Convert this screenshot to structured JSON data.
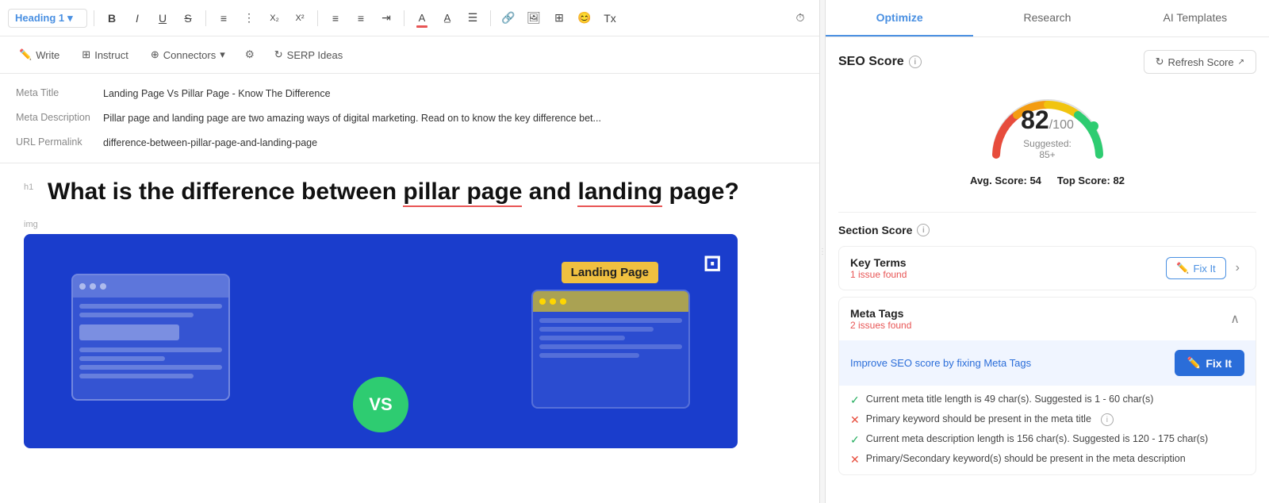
{
  "toolbar": {
    "heading_select": "Heading 1",
    "buttons": [
      "bold",
      "italic",
      "underline",
      "strikethrough",
      "ordered-list",
      "unordered-list",
      "subscript",
      "superscript",
      "align-left",
      "align-right",
      "indent",
      "outdent",
      "text-color",
      "text-bg",
      "align-center",
      "link",
      "image",
      "table",
      "emoji",
      "clear-format"
    ],
    "history_label": "⏱"
  },
  "secondary_toolbar": {
    "write_label": "Write",
    "instruct_label": "Instruct",
    "connectors_label": "Connectors",
    "serp_label": "SERP Ideas"
  },
  "meta": {
    "title_label": "Meta Title",
    "title_value": "Landing Page Vs Pillar Page - Know The Difference",
    "desc_label": "Meta Description",
    "desc_value": "Pillar page and landing page are two amazing ways of digital marketing. Read on to know the key difference bet...",
    "url_label": "URL Permalink",
    "url_value": "difference-between-pillar-page-and-landing-page"
  },
  "content": {
    "heading_tag": "h1",
    "article_title_part1": "What is the difference between ",
    "article_title_highlight1": "pillar page",
    "article_title_part2": " and ",
    "article_title_highlight2": "landing",
    "article_title_part3": " page?",
    "img_label": "img",
    "landing_page_label": "Landing Page",
    "vs_label": "VS"
  },
  "right_panel": {
    "tab_optimize": "Optimize",
    "tab_research": "Research",
    "tab_ai_templates": "AI Templates",
    "seo_score_title": "SEO Score",
    "refresh_btn": "Refresh Score",
    "score_value": "82",
    "score_denom": "/100",
    "score_suggested": "Suggested: 85+",
    "avg_score_label": "Avg. Score:",
    "avg_score_value": "54",
    "top_score_label": "Top Score:",
    "top_score_value": "82",
    "section_score_title": "Section Score",
    "key_terms_title": "Key Terms",
    "key_terms_issues": "1 issue found",
    "key_terms_fix": "Fix It",
    "meta_tags_title": "Meta Tags",
    "meta_tags_issues": "2 issues found",
    "improve_text": "Improve SEO score by fixing Meta Tags",
    "fix_it_label": "Fix It",
    "checks": [
      {
        "status": "pass",
        "text": "Current meta title length is 49 char(s). Suggested is 1 - 60 char(s)"
      },
      {
        "status": "fail",
        "text": "Primary keyword should be present in the meta title"
      },
      {
        "status": "pass",
        "text": "Current meta description length is 156 char(s). Suggested is 120 - 175 char(s)"
      },
      {
        "status": "fail",
        "text": "Primary/Secondary keyword(s) should be present in the meta description"
      }
    ]
  }
}
